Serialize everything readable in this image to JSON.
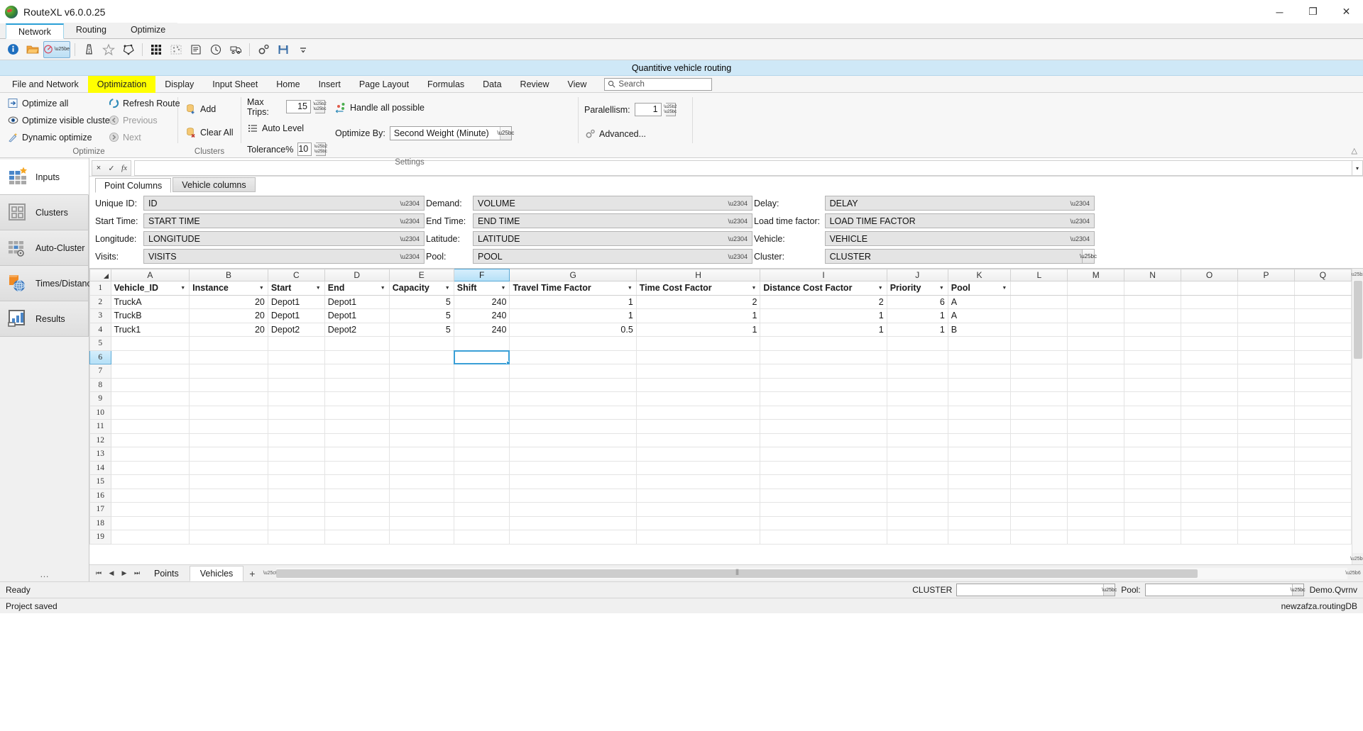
{
  "window": {
    "title": "RouteXL v6.0.0.25",
    "minimize": "─",
    "maximize": "❐",
    "close": "✕"
  },
  "mode_tabs": [
    {
      "label": "Network",
      "active": true
    },
    {
      "label": "Routing",
      "active": false
    },
    {
      "label": "Optimize",
      "active": false
    }
  ],
  "quick_access": [
    {
      "name": "info-icon",
      "glyph": "i"
    },
    {
      "name": "open-folder-icon",
      "glyph": "folder"
    },
    {
      "name": "optimize-clock-icon",
      "glyph": "gauge"
    },
    {
      "name": "road-icon",
      "glyph": "road"
    },
    {
      "name": "star-icon",
      "glyph": "star"
    },
    {
      "name": "polygon-icon",
      "glyph": "polygon"
    },
    {
      "name": "matrix-icon",
      "glyph": "matrix"
    },
    {
      "name": "cluster-map-icon",
      "glyph": "clustermap"
    },
    {
      "name": "report-icon",
      "glyph": "report"
    },
    {
      "name": "time-window-icon",
      "glyph": "timewin"
    },
    {
      "name": "truck-icon",
      "glyph": "truck"
    },
    {
      "name": "settings-gears-icon",
      "glyph": "gears"
    },
    {
      "name": "save-icon",
      "glyph": "save"
    },
    {
      "name": "more-icon",
      "glyph": "more"
    }
  ],
  "banner": {
    "text": "Quantitive vehicle routing"
  },
  "ribbon_tabs": [
    {
      "label": "File and Network",
      "active": false
    },
    {
      "label": "Optimization",
      "active": true
    },
    {
      "label": "Display",
      "active": false
    },
    {
      "label": "Input Sheet",
      "active": false
    },
    {
      "label": "Home",
      "active": false
    },
    {
      "label": "Insert",
      "active": false
    },
    {
      "label": "Page Layout",
      "active": false
    },
    {
      "label": "Formulas",
      "active": false
    },
    {
      "label": "Data",
      "active": false
    },
    {
      "label": "Review",
      "active": false
    },
    {
      "label": "View",
      "active": false
    }
  ],
  "ribbon_search": {
    "placeholder": "Search",
    "value": "Search"
  },
  "ribbon": {
    "optimize_group": {
      "label": "Optimize",
      "left_items": [
        {
          "label": "Optimize all",
          "icon": "optimize-all-icon",
          "disabled": false
        },
        {
          "label": "Optimize visible clusters",
          "icon": "optimize-visible-clusters-icon",
          "disabled": false
        },
        {
          "label": "Dynamic optimize",
          "icon": "dynamic-optimize-icon",
          "disabled": false
        }
      ],
      "right_items": [
        {
          "label": "Refresh Route",
          "icon": "refresh-route-icon",
          "disabled": false
        },
        {
          "label": "Previous",
          "icon": "previous-icon",
          "disabled": true
        },
        {
          "label": "Next",
          "icon": "next-icon",
          "disabled": true
        }
      ]
    },
    "clusters_group": {
      "label": "Clusters",
      "items": [
        {
          "label": "Add",
          "icon": "add-cluster-icon"
        },
        {
          "label": "Clear All",
          "icon": "clear-all-clusters-icon"
        }
      ]
    },
    "settings_group": {
      "label": "Settings",
      "max_trips_label": "Max Trips:",
      "max_trips_value": "15",
      "auto_level_label": "Auto Level",
      "tolerance_label": "Tolerance%",
      "tolerance_value": "10",
      "handle_all_label": "Handle all possible",
      "optimize_by_label": "Optimize By:",
      "optimize_by_value": "Second Weight (Minute)",
      "parallelism_label": "Paralellism:",
      "parallelism_value": "1",
      "advanced_label": "Advanced..."
    },
    "collapse_glyph": "△"
  },
  "sidebar": {
    "items": [
      {
        "label": "Inputs",
        "icon": "inputs-icon",
        "active": true
      },
      {
        "label": "Clusters",
        "icon": "clusters-icon",
        "active": false
      },
      {
        "label": "Auto-Cluster",
        "icon": "auto-cluster-icon",
        "active": false
      },
      {
        "label": "Times/Distances",
        "icon": "times-distances-icon",
        "active": false
      },
      {
        "label": "Results",
        "icon": "results-icon",
        "active": false
      }
    ],
    "overflow": "…"
  },
  "formula_bar": {
    "cancel": "×",
    "accept": "✓",
    "function": "fx",
    "value": "",
    "expand": "▾"
  },
  "map_panel": {
    "tabs": [
      {
        "label": "Point Columns",
        "active": true
      },
      {
        "label": "Vehicle columns",
        "active": false
      }
    ],
    "fields": [
      [
        {
          "label": "Unique ID:",
          "value": "ID"
        },
        {
          "label": "Demand:",
          "value": "VOLUME"
        },
        {
          "label": "Delay:",
          "value": "DELAY"
        }
      ],
      [
        {
          "label": "Start Time:",
          "value": "START TIME"
        },
        {
          "label": "End Time:",
          "value": "END TIME"
        },
        {
          "label": "Load time factor:",
          "value": "LOAD TIME FACTOR"
        }
      ],
      [
        {
          "label": "Longitude:",
          "value": "LONGITUDE"
        },
        {
          "label": "Latitude:",
          "value": "LATITUDE"
        },
        {
          "label": "Vehicle:",
          "value": "VEHICLE"
        }
      ],
      [
        {
          "label": "Visits:",
          "value": "VISITS"
        },
        {
          "label": "Pool:",
          "value": "POOL"
        },
        {
          "label": "Cluster:",
          "value": "CLUSTER"
        }
      ]
    ]
  },
  "sheet": {
    "column_letters": [
      "A",
      "B",
      "C",
      "D",
      "E",
      "F",
      "G",
      "H",
      "I",
      "J",
      "K",
      "L",
      "M",
      "N",
      "O",
      "P",
      "Q"
    ],
    "selected_column": "F",
    "selected_cell": {
      "row": 6,
      "col": "F"
    },
    "headers": [
      "Vehicle_ID",
      "Instance",
      "Start",
      "End",
      "Capacity",
      "Shift",
      "Travel Time Factor",
      "Time Cost Factor",
      "Distance Cost Factor",
      "Priority",
      "Pool",
      "",
      "",
      "",
      "",
      "",
      ""
    ],
    "rows": [
      {
        "n": 1,
        "type": "header"
      },
      {
        "n": 2,
        "cells": [
          "TruckA",
          "20",
          "Depot1",
          "Depot1",
          "5",
          "240",
          "1",
          "2",
          "2",
          "6",
          "A",
          "",
          "",
          "",
          "",
          "",
          ""
        ]
      },
      {
        "n": 3,
        "cells": [
          "TruckB",
          "20",
          "Depot1",
          "Depot1",
          "5",
          "240",
          "1",
          "1",
          "1",
          "1",
          "A",
          "",
          "",
          "",
          "",
          "",
          ""
        ]
      },
      {
        "n": 4,
        "cells": [
          "Truck1",
          "20",
          "Depot2",
          "Depot2",
          "5",
          "240",
          "0.5",
          "1",
          "1",
          "1",
          "B",
          "",
          "",
          "",
          "",
          "",
          ""
        ]
      },
      {
        "n": 5,
        "cells": [
          "",
          "",
          "",
          "",
          "",
          "",
          "",
          "",
          "",
          "",
          "",
          "",
          "",
          "",
          "",
          "",
          ""
        ]
      },
      {
        "n": 6,
        "cells": [
          "",
          "",
          "",
          "",
          "",
          "",
          "",
          "",
          "",
          "",
          "",
          "",
          "",
          "",
          "",
          "",
          ""
        ]
      },
      {
        "n": 7,
        "cells": [
          "",
          "",
          "",
          "",
          "",
          "",
          "",
          "",
          "",
          "",
          "",
          "",
          "",
          "",
          "",
          "",
          ""
        ]
      },
      {
        "n": 8,
        "cells": [
          "",
          "",
          "",
          "",
          "",
          "",
          "",
          "",
          "",
          "",
          "",
          "",
          "",
          "",
          "",
          "",
          ""
        ]
      },
      {
        "n": 9,
        "cells": [
          "",
          "",
          "",
          "",
          "",
          "",
          "",
          "",
          "",
          "",
          "",
          "",
          "",
          "",
          "",
          "",
          ""
        ]
      },
      {
        "n": 10,
        "cells": [
          "",
          "",
          "",
          "",
          "",
          "",
          "",
          "",
          "",
          "",
          "",
          "",
          "",
          "",
          "",
          "",
          ""
        ]
      },
      {
        "n": 11,
        "cells": [
          "",
          "",
          "",
          "",
          "",
          "",
          "",
          "",
          "",
          "",
          "",
          "",
          "",
          "",
          "",
          "",
          ""
        ]
      },
      {
        "n": 12,
        "cells": [
          "",
          "",
          "",
          "",
          "",
          "",
          "",
          "",
          "",
          "",
          "",
          "",
          "",
          "",
          "",
          "",
          ""
        ]
      },
      {
        "n": 13,
        "cells": [
          "",
          "",
          "",
          "",
          "",
          "",
          "",
          "",
          "",
          "",
          "",
          "",
          "",
          "",
          "",
          "",
          ""
        ]
      },
      {
        "n": 14,
        "cells": [
          "",
          "",
          "",
          "",
          "",
          "",
          "",
          "",
          "",
          "",
          "",
          "",
          "",
          "",
          "",
          "",
          ""
        ]
      },
      {
        "n": 15,
        "cells": [
          "",
          "",
          "",
          "",
          "",
          "",
          "",
          "",
          "",
          "",
          "",
          "",
          "",
          "",
          "",
          "",
          ""
        ]
      },
      {
        "n": 16,
        "cells": [
          "",
          "",
          "",
          "",
          "",
          "",
          "",
          "",
          "",
          "",
          "",
          "",
          "",
          "",
          "",
          "",
          ""
        ]
      },
      {
        "n": 17,
        "cells": [
          "",
          "",
          "",
          "",
          "",
          "",
          "",
          "",
          "",
          "",
          "",
          "",
          "",
          "",
          "",
          "",
          ""
        ]
      },
      {
        "n": 18,
        "cells": [
          "",
          "",
          "",
          "",
          "",
          "",
          "",
          "",
          "",
          "",
          "",
          "",
          "",
          "",
          "",
          "",
          ""
        ]
      },
      {
        "n": 19,
        "cells": [
          "",
          "",
          "",
          "",
          "",
          "",
          "",
          "",
          "",
          "",
          "",
          "",
          "",
          "",
          "",
          "",
          ""
        ]
      }
    ],
    "numeric_columns": [
      1,
      4,
      5,
      6,
      7,
      8,
      9
    ]
  },
  "sheet_tabs": {
    "first": "⏮",
    "prev": "◀",
    "next": "▶",
    "last": "⏭",
    "tabs": [
      {
        "label": "Points",
        "active": false
      },
      {
        "label": "Vehicles",
        "active": true
      }
    ],
    "add": "+"
  },
  "status_bar": {
    "state": "Ready",
    "cluster_label": "CLUSTER",
    "cluster_value": "",
    "pool_label": "Pool:",
    "pool_value": "",
    "document": "Demo.Qvrnv"
  },
  "bottom_bar": {
    "message": "Project saved",
    "database": "newzafza.routingDB"
  },
  "colors": {
    "accent": "#2a9fd6",
    "banner": "#cfe8f7",
    "highlight": "#ffff00",
    "selection": "#b5e0f7"
  }
}
